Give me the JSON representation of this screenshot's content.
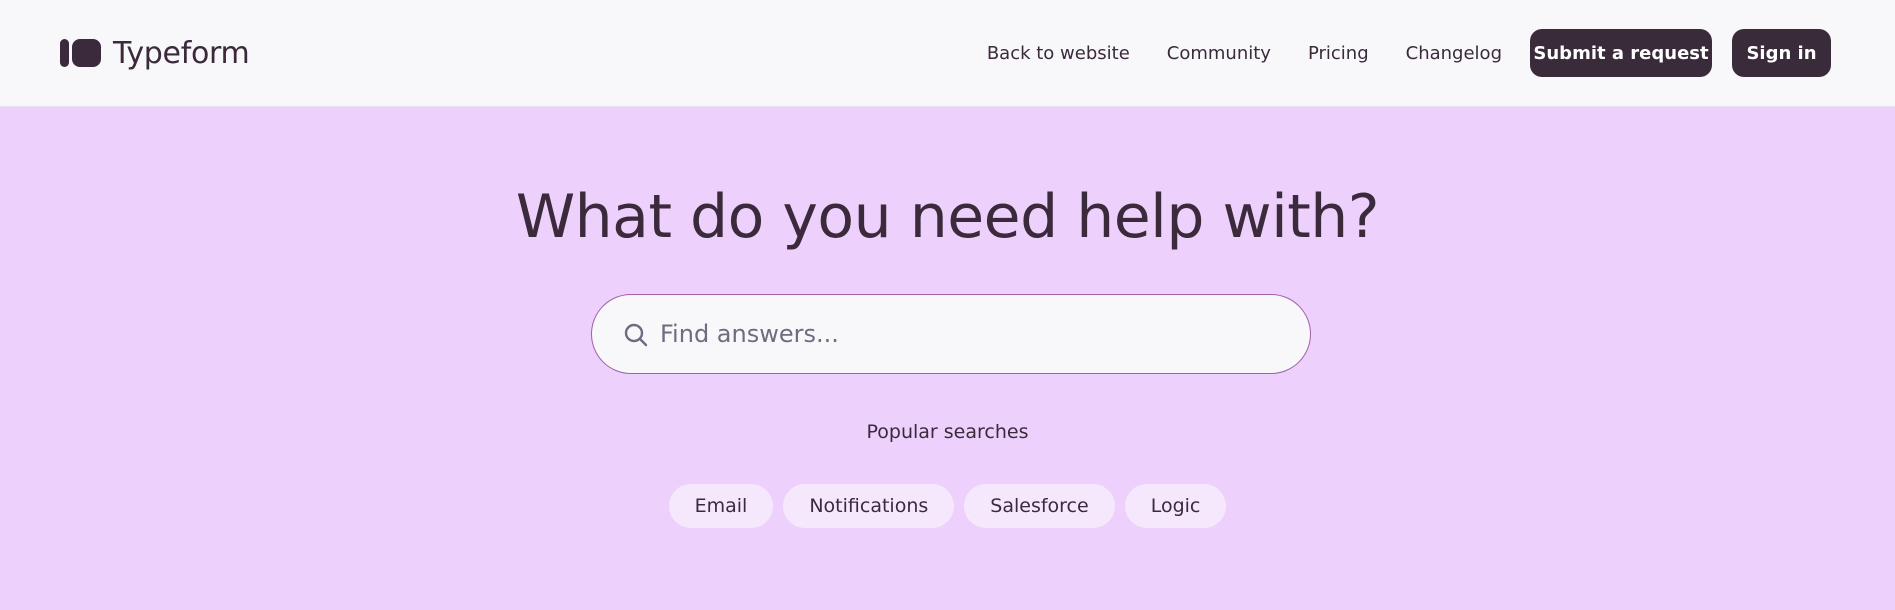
{
  "header": {
    "logo_text": "Typeform",
    "nav_links": [
      "Back to website",
      "Community",
      "Pricing",
      "Changelog"
    ],
    "submit_label": "Submit a request",
    "signin_label": "Sign in"
  },
  "hero": {
    "title": "What do you need help with?",
    "search": {
      "placeholder": "Find answers...",
      "value": "",
      "icon": "search-icon"
    },
    "popular_label": "Popular searches",
    "chips": [
      "Email",
      "Notifications",
      "Salesforce",
      "Logic"
    ]
  },
  "colors": {
    "header_bg": "#F8F7FA",
    "hero_bg": "#EDD0FB",
    "text_dark": "#3A2A3C",
    "button_dark": "#3A2B3B",
    "chip_bg": "#F6E8FC",
    "search_border": "#A25FA6"
  }
}
